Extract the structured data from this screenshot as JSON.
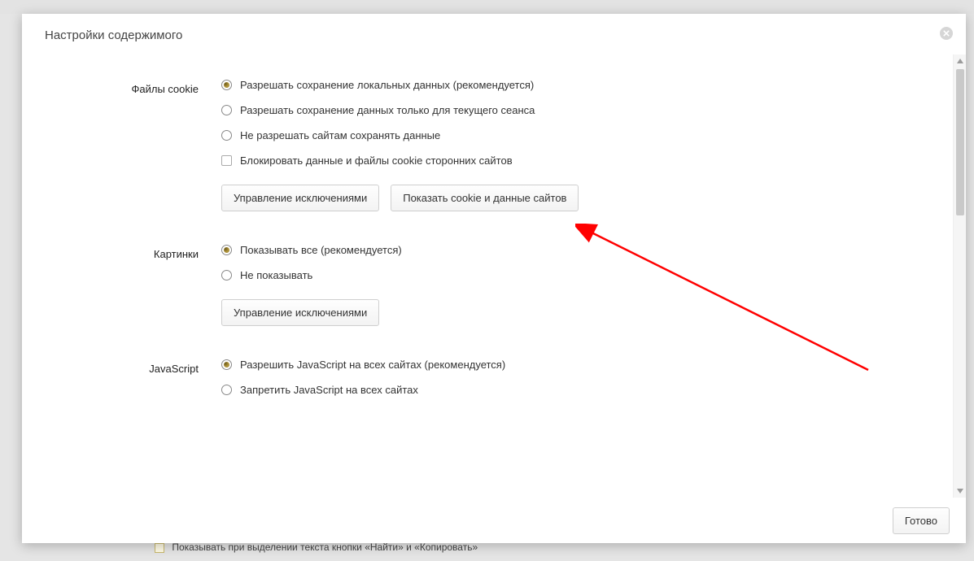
{
  "dialog": {
    "title": "Настройки содержимого",
    "footer_done": "Готово"
  },
  "behind": {
    "text": "Показывать при выделении текста кнопки «Найти» и «Копировать»"
  },
  "sections": {
    "cookies": {
      "label": "Файлы cookie",
      "options": [
        "Разрешать сохранение локальных данных (рекомендуется)",
        "Разрешать сохранение данных только для текущего сеанса",
        "Не разрешать сайтам сохранять данные"
      ],
      "checkbox": "Блокировать данные и файлы cookie сторонних сайтов",
      "buttons": {
        "exceptions": "Управление исключениями",
        "show_cookies": "Показать cookie и данные сайтов"
      }
    },
    "images": {
      "label": "Картинки",
      "options": [
        "Показывать все (рекомендуется)",
        "Не показывать"
      ],
      "buttons": {
        "exceptions": "Управление исключениями"
      }
    },
    "javascript": {
      "label": "JavaScript",
      "options": [
        "Разрешить JavaScript на всех сайтах (рекомендуется)",
        "Запретить JavaScript на всех сайтах"
      ]
    }
  }
}
